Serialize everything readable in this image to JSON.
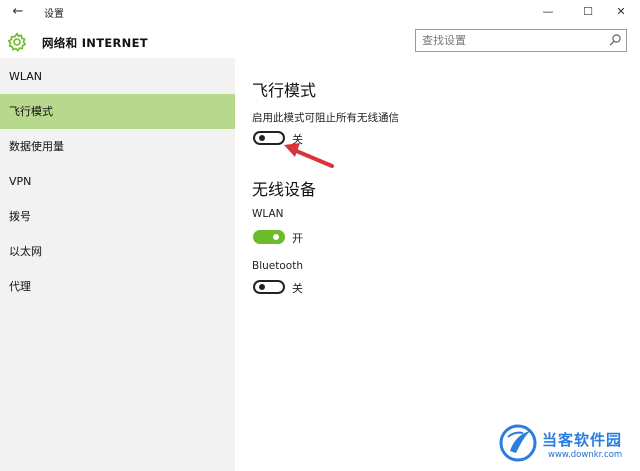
{
  "window": {
    "back_glyph": "←",
    "title": "设置",
    "minimize_glyph": "—",
    "maximize_glyph": "☐",
    "close_glyph": "✕"
  },
  "header": {
    "icon": "gear-icon",
    "title": "网络和 INTERNET",
    "search_placeholder": "查找设置"
  },
  "sidebar": {
    "active_color": "#b8d88e",
    "items": [
      {
        "label": "WLAN"
      },
      {
        "label": "飞行模式",
        "active": true
      },
      {
        "label": "数据使用量"
      },
      {
        "label": "VPN"
      },
      {
        "label": "拨号"
      },
      {
        "label": "以太网"
      },
      {
        "label": "代理"
      }
    ]
  },
  "main": {
    "airplane_mode": {
      "heading": "飞行模式",
      "description": "启用此模式可阻止所有无线通信",
      "state_label": "关"
    },
    "wireless_devices": {
      "heading": "无线设备",
      "wlan": {
        "label": "WLAN",
        "state_label": "开"
      },
      "bluetooth": {
        "label": "Bluetooth",
        "state_label": "关"
      }
    },
    "toggle_on_color": "#6bbb2a",
    "annotation_arrow_color": "#d8343a"
  },
  "watermark": {
    "title": "当客软件园",
    "url": "www.downkr.com"
  }
}
